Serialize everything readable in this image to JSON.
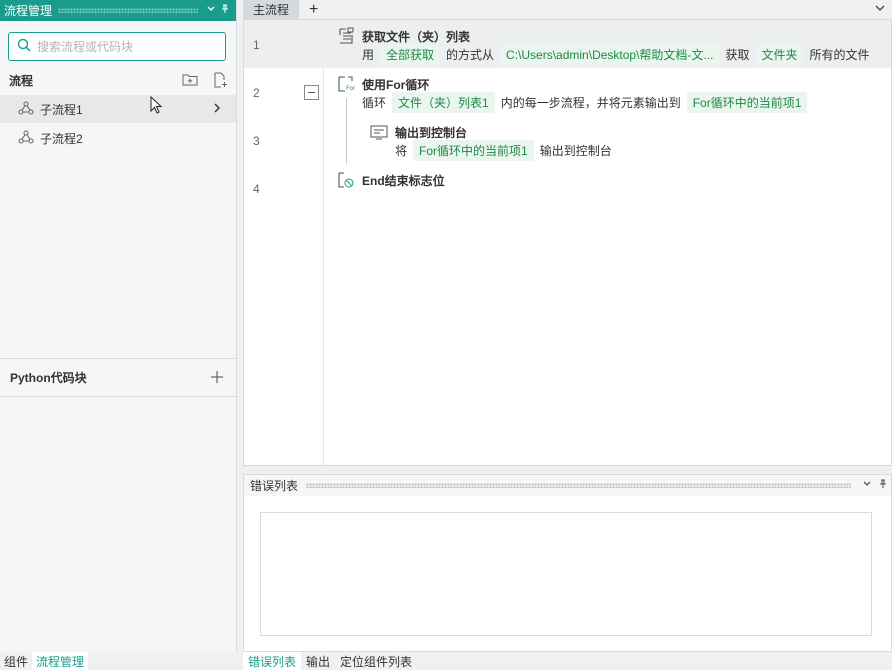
{
  "left_panel": {
    "title": "流程管理",
    "search_placeholder": "搜索流程或代码块",
    "flows_heading": "流程",
    "flows": [
      {
        "label": "子流程1"
      },
      {
        "label": "子流程2"
      }
    ],
    "python_heading": "Python代码块",
    "bottom_tabs": [
      "组件",
      "流程管理"
    ]
  },
  "editor": {
    "tab_label": "主流程",
    "tab_add": "+",
    "steps": [
      {
        "line": "1",
        "title": "获取文件（夹）列表",
        "desc": {
          "t1": "用",
          "c1": "全部获取",
          "t2": "的方式从",
          "c2": "C:\\Users\\admin\\Desktop\\帮助文档-文...",
          "t3": "获取",
          "c3": "文件夹",
          "t4": "所有的文件"
        }
      },
      {
        "line": "2",
        "title": "使用For循环",
        "desc": {
          "t1": "循环",
          "c1": "文件（夹）列表1",
          "t2": "内的每一步流程，并将元素输出到",
          "c2": "For循环中的当前项1"
        }
      },
      {
        "line": "3",
        "title": "输出到控制台",
        "desc": {
          "t1": "将",
          "c1": "For循环中的当前项1",
          "t2": "输出到控制台"
        }
      },
      {
        "line": "4",
        "title": "End结束标志位"
      }
    ]
  },
  "error_panel": {
    "title": "错误列表",
    "bottom_tabs": [
      "错误列表",
      "输出",
      "定位组件列表"
    ]
  },
  "colors": {
    "accent": "#1a9c8c",
    "chip_bg": "#e9f5ee",
    "chip_text": "#1e8a45"
  }
}
